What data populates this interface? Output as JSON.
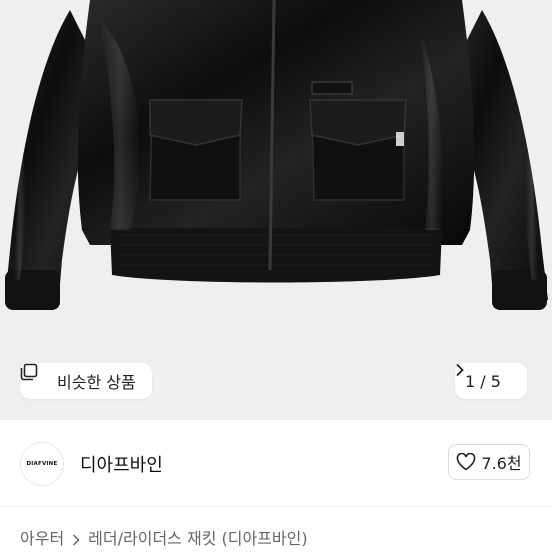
{
  "gallery": {
    "similar_label": "비슷한 상품",
    "counter": "1 / 5",
    "image_alt": "black leather bomber jacket"
  },
  "seller": {
    "logo_text": "DIAFVINE",
    "name": "디아프바인",
    "likes": "7.6천"
  },
  "breadcrumb": {
    "category": "아우터",
    "subcategory": "레더/라이더스 재킷 (디아프바인)"
  },
  "icons": {
    "similar": "copy-icon",
    "next": "chevron-right-icon",
    "like": "heart-icon",
    "breadcrumb_sep": "chevron-right-icon"
  },
  "colors": {
    "hero_bg": "#efefef",
    "jacket": "#151515",
    "text": "#222222",
    "muted": "#666666"
  }
}
